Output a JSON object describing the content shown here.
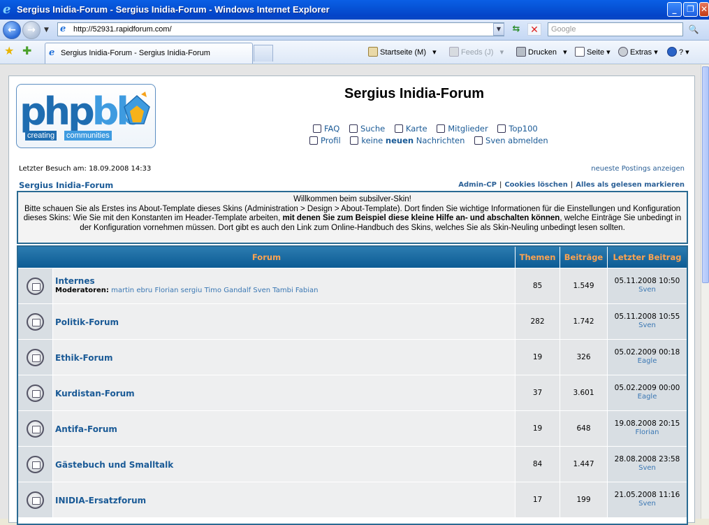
{
  "window": {
    "title": "Sergius Inidia-Forum - Sergius Inidia-Forum - Windows Internet Explorer",
    "minimize_label": "_",
    "maximize_label": "❐",
    "close_label": "✕"
  },
  "address": {
    "url": "http://52931.rapidforum.com/",
    "search_placeholder": "Google"
  },
  "tab": {
    "title": "Sergius Inidia-Forum - Sergius Inidia-Forum"
  },
  "commands": {
    "home": "Startseite (M)",
    "feeds": "Feeds (J)",
    "print": "Drucken",
    "page": "Seite",
    "tools": "Extras",
    "help": "?"
  },
  "forum": {
    "logo": {
      "php": "php",
      "bb": "bb",
      "tag1": "creating",
      "tag2": "communities"
    },
    "site_name": "Sergius Inidia-Forum",
    "nav1": [
      "FAQ",
      "Suche",
      "Karte",
      "Mitglieder",
      "Top100"
    ],
    "nav2": {
      "profile": "Profil",
      "messages_pre": "keine ",
      "messages_bold": "neuen",
      "messages_post": " Nachrichten",
      "logout": "Sven abmelden"
    },
    "last_visit": "Letzter Besuch am: 18.09.2008 14:33",
    "newest_posts": "neueste Postings anzeigen",
    "breadcrumb": "Sergius Inidia-Forum",
    "right_links": [
      "Admin-CP",
      "Cookies löschen",
      "Alles als gelesen markieren"
    ],
    "welcome": {
      "line1": "Willkommen beim subsilver-Skin!",
      "text_a": "Bitte schauen Sie als Erstes ins About-Template dieses Skins (Administration > Design > About-Template). Dort finden Sie wichtige Informationen für die Einstellungen und Konfiguration dieses Skins: Wie Sie mit den Konstanten im Header-Template arbeiten, ",
      "text_bold": "mit denen Sie zum Beispiel diese kleine Hilfe an- und abschalten können",
      "text_b": ", welche Einträge Sie unbedingt in der Konfiguration vornehmen müssen. Dort gibt es auch den Link zum Online-Handbuch des Skins, welches Sie als Skin-Neuling unbedingt lesen sollten."
    },
    "table": {
      "headers": {
        "forum": "Forum",
        "themen": "Themen",
        "beitraege": "Beiträge",
        "letzter": "Letzter Beitrag"
      },
      "moderators_label": "Moderatoren:",
      "rows": [
        {
          "name": "Internes",
          "moderators": "martin ebru Florian sergiu Timo Gandalf Sven Tambi Fabian",
          "themen": "85",
          "beitraege": "1.549",
          "date": "05.11.2008 10:50",
          "user": "Sven"
        },
        {
          "name": "Politik-Forum",
          "themen": "282",
          "beitraege": "1.742",
          "date": "05.11.2008 10:55",
          "user": "Sven"
        },
        {
          "name": "Ethik-Forum",
          "themen": "19",
          "beitraege": "326",
          "date": "05.02.2009 00:18",
          "user": "Eagle"
        },
        {
          "name": "Kurdistan-Forum",
          "themen": "37",
          "beitraege": "3.601",
          "date": "05.02.2009 00:00",
          "user": "Eagle"
        },
        {
          "name": "Antifa-Forum",
          "themen": "19",
          "beitraege": "648",
          "date": "19.08.2008 20:15",
          "user": "Florian"
        },
        {
          "name": "Gästebuch und Smalltalk",
          "themen": "84",
          "beitraege": "1.447",
          "date": "28.08.2008 23:58",
          "user": "Sven"
        },
        {
          "name": "INIDIA-Ersatzforum",
          "themen": "17",
          "beitraege": "199",
          "date": "21.05.2008 11:16",
          "user": "Sven"
        }
      ]
    }
  }
}
